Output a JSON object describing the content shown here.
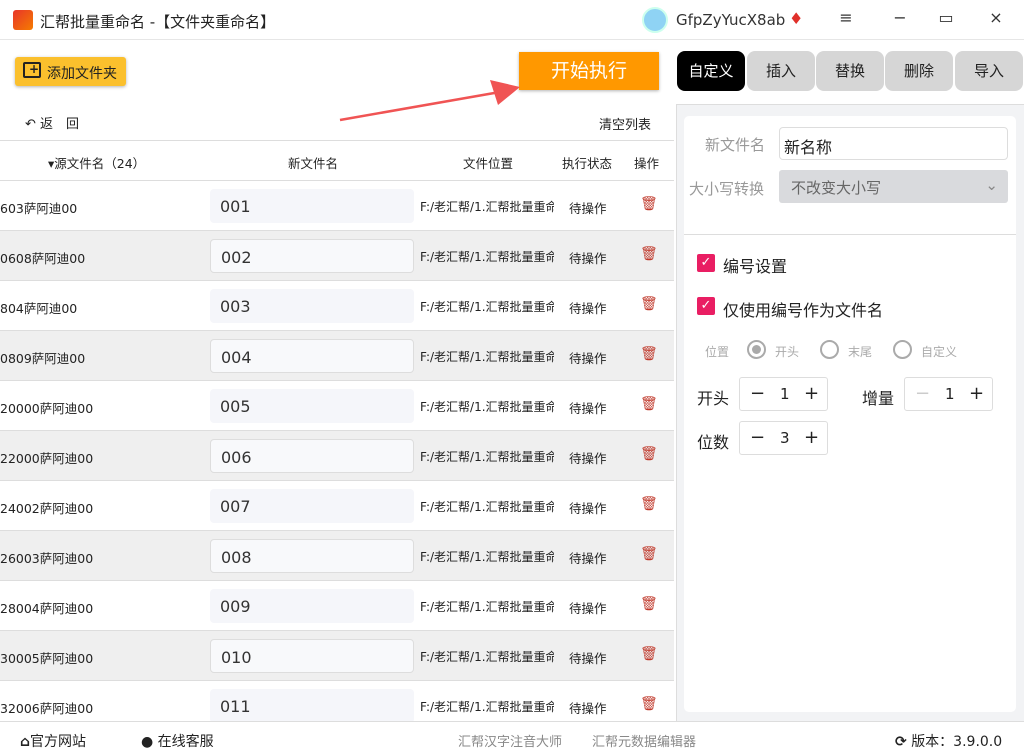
{
  "window": {
    "title": "汇帮批量重命名 -【文件夹重命名】",
    "user": "GfpZyYucX8ab",
    "vip_icon": "diamond-icon",
    "min": "−",
    "max": "▭",
    "close": "×",
    "menu": "≡"
  },
  "toolbar": {
    "add_folder": "添加文件夹",
    "start": "开始执行",
    "back": "返　回",
    "clear": "清空列表"
  },
  "table": {
    "headers": {
      "source": "▾源文件名（24）",
      "new": "新文件名",
      "location": "文件位置",
      "status": "执行状态",
      "action": "操作"
    },
    "rows": [
      {
        "source": "603萨阿迪00",
        "new": "001",
        "location": "F:/老汇帮/1.汇帮批量重命",
        "status": "待操作"
      },
      {
        "source": "0608萨阿迪00",
        "new": "002",
        "location": "F:/老汇帮/1.汇帮批量重命",
        "status": "待操作"
      },
      {
        "source": "804萨阿迪00",
        "new": "003",
        "location": "F:/老汇帮/1.汇帮批量重命",
        "status": "待操作"
      },
      {
        "source": "0809萨阿迪00",
        "new": "004",
        "location": "F:/老汇帮/1.汇帮批量重命",
        "status": "待操作"
      },
      {
        "source": "20000萨阿迪00",
        "new": "005",
        "location": "F:/老汇帮/1.汇帮批量重命",
        "status": "待操作"
      },
      {
        "source": "22000萨阿迪00",
        "new": "006",
        "location": "F:/老汇帮/1.汇帮批量重命",
        "status": "待操作"
      },
      {
        "source": "24002萨阿迪00",
        "new": "007",
        "location": "F:/老汇帮/1.汇帮批量重命",
        "status": "待操作"
      },
      {
        "source": "26003萨阿迪00",
        "new": "008",
        "location": "F:/老汇帮/1.汇帮批量重命",
        "status": "待操作"
      },
      {
        "source": "28004萨阿迪00",
        "new": "009",
        "location": "F:/老汇帮/1.汇帮批量重命",
        "status": "待操作"
      },
      {
        "source": "30005萨阿迪00",
        "new": "010",
        "location": "F:/老汇帮/1.汇帮批量重命",
        "status": "待操作"
      },
      {
        "source": "32006萨阿迪00",
        "new": "011",
        "location": "F:/老汇帮/1.汇帮批量重命",
        "status": "待操作"
      }
    ]
  },
  "tabs": [
    "自定义",
    "插入",
    "替换",
    "删除",
    "导入"
  ],
  "panel": {
    "new_name_label": "新文件名",
    "new_name_value": "新名称",
    "case_label": "大小写转换",
    "case_value": "不改变大小写",
    "numbering_label": "编号设置",
    "only_number_label": "仅使用编号作为文件名",
    "position_label": "位置",
    "positions": [
      "开头",
      "末尾",
      "自定义"
    ],
    "start_label": "开头",
    "start_value": "1",
    "step_label": "增量",
    "step_value": "1",
    "digits_label": "位数",
    "digits_value": "3"
  },
  "footer": {
    "website": "官方网站",
    "support": "在线客服",
    "link1": "汇帮汉字注音大师",
    "link2": "汇帮元数据编辑器",
    "version": "版本：3.9.0.0"
  },
  "colors": {
    "accent": "#ff9800",
    "add": "#fbc02d",
    "check": "#e91e63"
  }
}
